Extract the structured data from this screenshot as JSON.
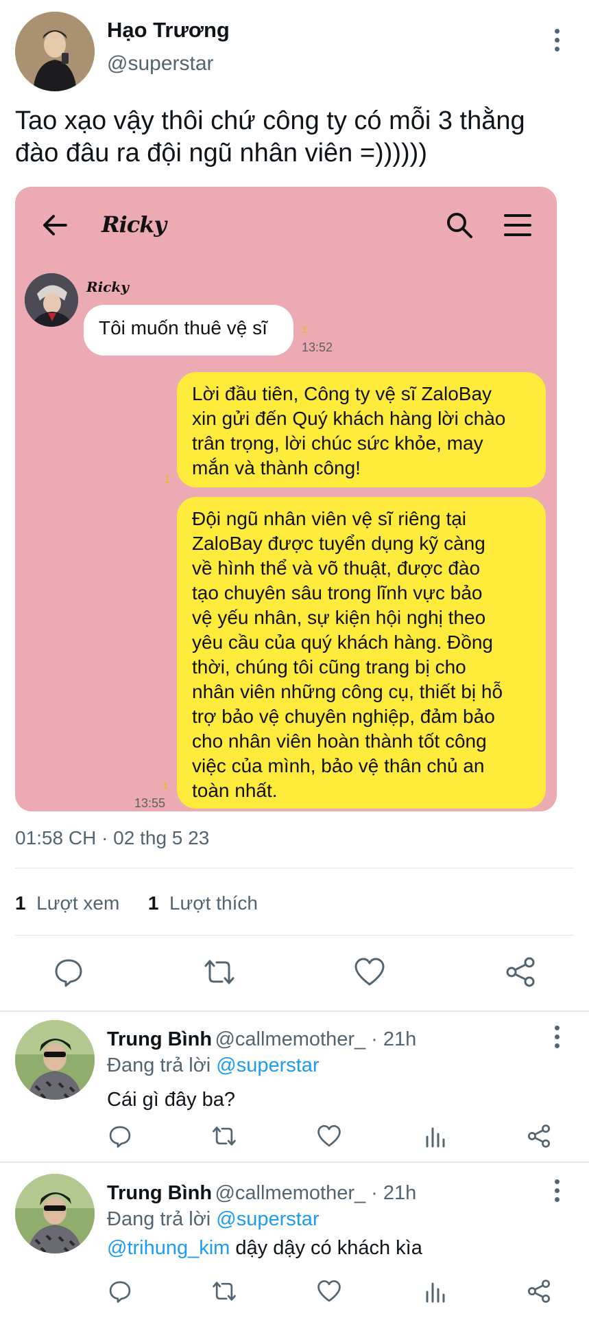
{
  "tweet": {
    "author_name": "Hạo Trương",
    "author_handle": "@superstar",
    "text_line1": "Tao xạo vậy thôi chứ công ty có mỗi 3 thằng",
    "text_line2": "đào đâu ra đội ngũ nhân viên =))))))",
    "timestamp": "01:58 CH · 02 thg 5 23",
    "views_count": "1",
    "views_label": "Lượt xem",
    "likes_count": "1",
    "likes_label": "Lượt thích"
  },
  "chat": {
    "title": "Ricky",
    "sender_name": "Ricky",
    "incoming_message": "Tôi muốn thuê vệ sĩ",
    "incoming_read": "1",
    "incoming_time": "13:52",
    "outgoing_1_lines": [
      "Lời đầu tiên, Công ty vệ sĩ ZaloBay",
      "xin gửi đến Quý khách hàng lời chào",
      "trân trọng, lời chúc sức khỏe, may",
      "mắn và thành công!"
    ],
    "outgoing_1_read": "1",
    "outgoing_2_lines": [
      "Đội ngũ nhân viên vệ sĩ riêng tại",
      "ZaloBay được tuyển dụng kỹ càng",
      "về hình thể và võ thuật, được đào",
      "tạo chuyên sâu trong lĩnh vực bảo",
      "vệ yếu nhân, sự kiện hội nghị theo",
      "yêu cầu của quý khách hàng. Đồng",
      "thời, chúng tôi cũng trang bị cho",
      "nhân viên những công cụ, thiết bị hỗ",
      "trợ bảo vệ chuyên nghiệp, đảm bảo",
      "cho nhân viên hoàn thành tốt công",
      "việc của mình, bảo vệ thân chủ an",
      "toàn nhất."
    ],
    "outgoing_2_read": "1",
    "outgoing_2_time": "13:55"
  },
  "replies": [
    {
      "name": "Trung Bình",
      "handle": "@callmemother_",
      "age": " · 21h",
      "replying_prefix": "Đang trả lời ",
      "replying_to": "@superstar",
      "mention": "",
      "body": "Cái gì đây ba?"
    },
    {
      "name": "Trung Bình",
      "handle": "@callmemother_",
      "age": " · 21h",
      "replying_prefix": "Đang trả lời ",
      "replying_to": "@superstar",
      "mention": "@trihung_kim",
      "body": " dậy dậy có khách kìa"
    }
  ],
  "icons": {
    "reply": "reply-icon",
    "retweet": "retweet-icon",
    "like": "heart-icon",
    "share": "share-icon",
    "analytics": "analytics-icon",
    "more": "more-vertical-icon",
    "back": "arrow-left-icon",
    "search": "search-icon",
    "menu": "menu-icon"
  },
  "colors": {
    "chat_background": "#ecaab3",
    "outgoing_bubble": "#ffeb3b",
    "link": "#1d9bf0",
    "secondary_text": "#536471"
  }
}
